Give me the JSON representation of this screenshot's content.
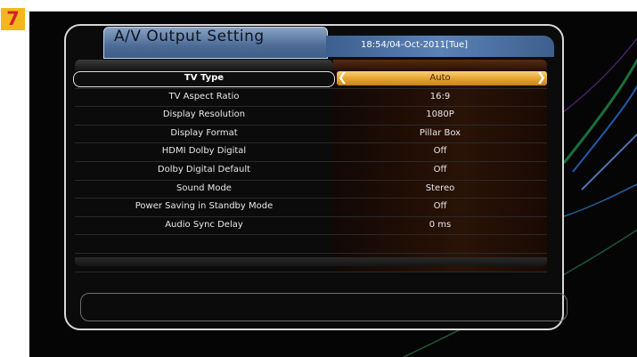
{
  "badge": {
    "step": "7"
  },
  "header": {
    "title": "A/V Output Setting",
    "clock": "18:54/04-Oct-2011[Tue]"
  },
  "settings": [
    {
      "label": "TV Type",
      "value": "Auto",
      "selected": true
    },
    {
      "label": "TV Aspect Ratio",
      "value": "16:9"
    },
    {
      "label": "Display Resolution",
      "value": "1080P"
    },
    {
      "label": "Display Format",
      "value": "Pillar Box"
    },
    {
      "label": "HDMI Dolby Digital",
      "value": "Off"
    },
    {
      "label": "Dolby Digital Default",
      "value": "Off"
    },
    {
      "label": "Sound Mode",
      "value": "Stereo"
    },
    {
      "label": "Power Saving in Standby Mode",
      "value": "Off"
    },
    {
      "label": "Audio Sync Delay",
      "value": "0 ms"
    }
  ],
  "icons": {
    "left": "chevron-left-icon",
    "right": "chevron-right-icon"
  },
  "colors": {
    "accent": "#e6a22c",
    "title_bar": "#4c6c95",
    "badge": "#f2b81b"
  }
}
